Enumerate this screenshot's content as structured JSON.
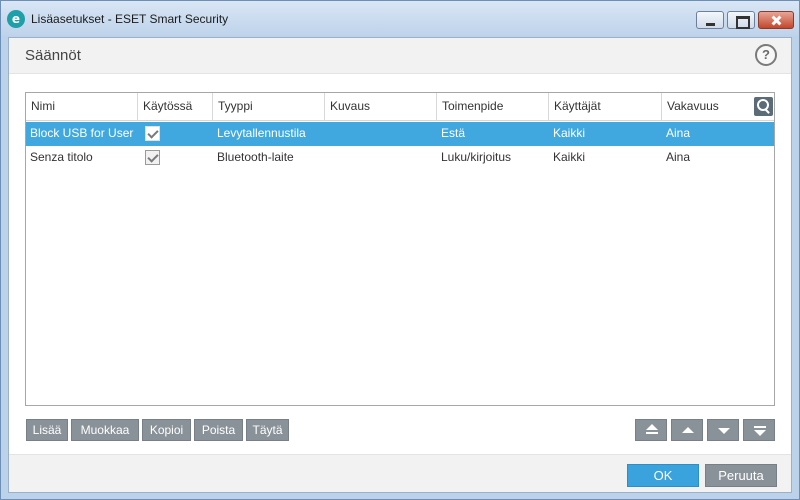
{
  "window": {
    "title": "Lisäasetukset - ESET Smart Security",
    "logo_letter": "e"
  },
  "header": {
    "title": "Säännöt",
    "help_label": "?"
  },
  "table": {
    "columns": [
      "Nimi",
      "Käytössä",
      "Tyyppi",
      "Kuvaus",
      "Toimenpide",
      "Käyttäjät",
      "Vakavuus"
    ],
    "rows": [
      {
        "name": "Block USB for User",
        "enabled": true,
        "type": "Levytallennustila",
        "description": "",
        "action": "Estä",
        "users": "Kaikki",
        "severity": "Aina",
        "selected": true
      },
      {
        "name": "Senza titolo",
        "enabled": true,
        "type": "Bluetooth-laite",
        "description": "",
        "action": "Luku/kirjoitus",
        "users": "Kaikki",
        "severity": "Aina",
        "selected": false
      }
    ]
  },
  "toolbar": {
    "add_label": "Lisää",
    "edit_label": "Muokkaa",
    "copy_label": "Kopioi",
    "delete_label": "Poista",
    "populate_label": "Täytä"
  },
  "footer": {
    "ok_label": "OK",
    "cancel_label": "Peruuta"
  },
  "colors": {
    "accent": "#41a8df",
    "button_gray": "#8a9299"
  }
}
